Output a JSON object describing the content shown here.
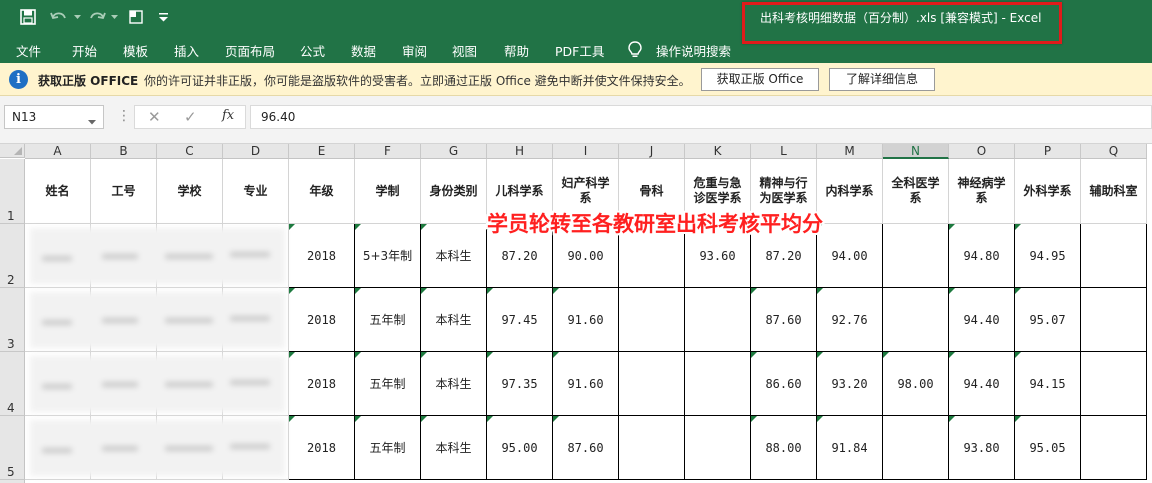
{
  "window": {
    "title": "出科考核明细数据（百分制）.xls  [兼容模式]  -  Excel"
  },
  "colors": {
    "brand": "#217346",
    "alert": "#e01b1b",
    "annotation": "#ff2020",
    "msgbar": "#fff4ce"
  },
  "quick_access": [
    "save-icon",
    "undo-icon",
    "redo-icon",
    "touch-mode-icon",
    "customize-icon"
  ],
  "ribbon": {
    "tabs": [
      "文件",
      "开始",
      "模板",
      "插入",
      "页面布局",
      "公式",
      "数据",
      "审阅",
      "视图",
      "帮助",
      "PDF工具"
    ],
    "tell_me": "操作说明搜索"
  },
  "message_bar": {
    "title": "获取正版 OFFICE",
    "text": "你的许可证并非正版，你可能是盗版软件的受害者。立即通过正版 Office 避免中断并使文件保持安全。",
    "button_primary": "获取正版 Office",
    "button_secondary": "了解详细信息"
  },
  "formula_bar": {
    "cell_ref": "N13",
    "cancel": "✕",
    "enter": "✓",
    "fx": "fx",
    "value": "96.40"
  },
  "sheet": {
    "columns": [
      "A",
      "B",
      "C",
      "D",
      "E",
      "F",
      "G",
      "H",
      "I",
      "J",
      "K",
      "L",
      "M",
      "N",
      "O",
      "P",
      "Q"
    ],
    "selected_column": "N",
    "row_numbers": [
      "1",
      "2",
      "3",
      "4",
      "5"
    ],
    "headers": [
      "姓名",
      "工号",
      "学校",
      "专业",
      "年级",
      "学制",
      "身份类别",
      "儿科学系",
      "妇产科学系",
      "骨科",
      "危重与急诊医学系",
      "精神与行为医学系",
      "内科学系",
      "全科医学系",
      "神经病学系",
      "外科学系",
      "辅助科室"
    ],
    "rows": [
      [
        "",
        "",
        "",
        "",
        "2018",
        "5+3年制",
        "本科生",
        "87.20",
        "90.00",
        "",
        "93.60",
        "87.20",
        "94.00",
        "",
        "94.80",
        "94.95",
        ""
      ],
      [
        "",
        "",
        "",
        "",
        "2018",
        "五年制",
        "本科生",
        "97.45",
        "91.60",
        "",
        "",
        "87.60",
        "92.76",
        "",
        "94.40",
        "95.07",
        ""
      ],
      [
        "",
        "",
        "",
        "",
        "2018",
        "五年制",
        "本科生",
        "97.35",
        "91.60",
        "",
        "",
        "86.60",
        "93.20",
        "98.00",
        "94.40",
        "94.15",
        ""
      ],
      [
        "",
        "",
        "",
        "",
        "2018",
        "五年制",
        "本科生",
        "95.00",
        "87.60",
        "",
        "",
        "88.00",
        "91.84",
        "",
        "93.80",
        "95.05",
        ""
      ]
    ],
    "annotation": "学员轮转至各教研室出科考核平均分"
  }
}
